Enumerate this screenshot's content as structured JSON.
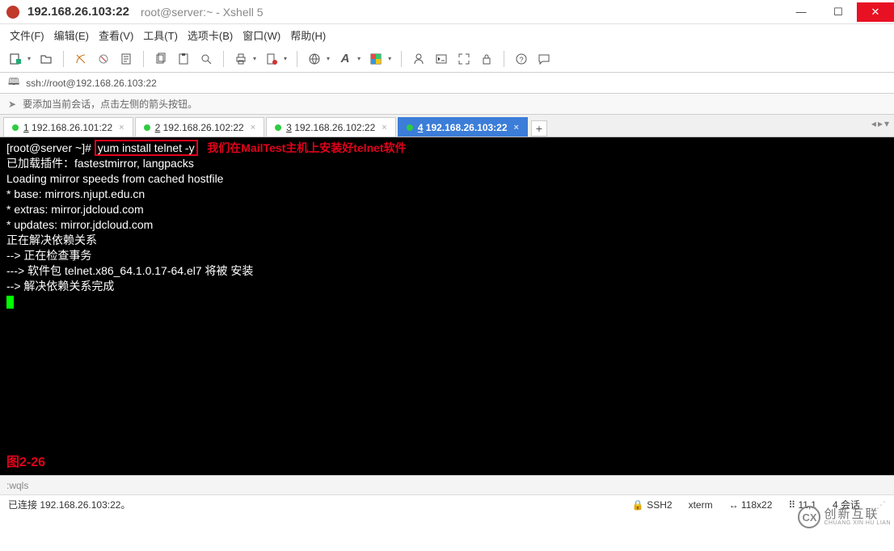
{
  "title_main": "192.168.26.103:22",
  "title_sub": "root@server:~ - Xshell 5",
  "menu": [
    "文件(F)",
    "编辑(E)",
    "查看(V)",
    "工具(T)",
    "选项卡(B)",
    "窗口(W)",
    "帮助(H)"
  ],
  "address": "ssh://root@192.168.26.103:22",
  "hint": "要添加当前会话，点击左侧的箭头按钮。",
  "tabs": [
    {
      "key": "1",
      "label": "192.168.26.101:22",
      "active": false
    },
    {
      "key": "2",
      "label": "192.168.26.102:22",
      "active": false
    },
    {
      "key": "3",
      "label": "192.168.26.102:22",
      "active": false
    },
    {
      "key": "4",
      "label": "192.168.26.103:22",
      "active": true
    }
  ],
  "terminal": {
    "prompt": "[root@server ~]# ",
    "command": "yum install telnet -y",
    "annotation": "我们在MailTest主机上安装好telnet软件",
    "lines": [
      "已加载插件：fastestmirror, langpacks",
      "Loading mirror speeds from cached hostfile",
      " * base: mirrors.njupt.edu.cn",
      " * extras: mirror.jdcloud.com",
      " * updates: mirror.jdcloud.com",
      "正在解决依赖关系",
      "--> 正在检查事务",
      "---> 软件包 telnet.x86_64.1.0.17-64.el7 将被 安装",
      "--> 解决依赖关系完成"
    ],
    "figure_label": "图2-26"
  },
  "inputbar": ":wqls",
  "status": {
    "conn": "已连接 192.168.26.103:22。",
    "proto": "SSH2",
    "term": "xterm",
    "size": "118x22",
    "pos": "11,1",
    "sess": "4 会话"
  },
  "watermark": {
    "cn": "创新互联",
    "en": "CHUANG XIN HU LIAN",
    "logo": "CX"
  }
}
